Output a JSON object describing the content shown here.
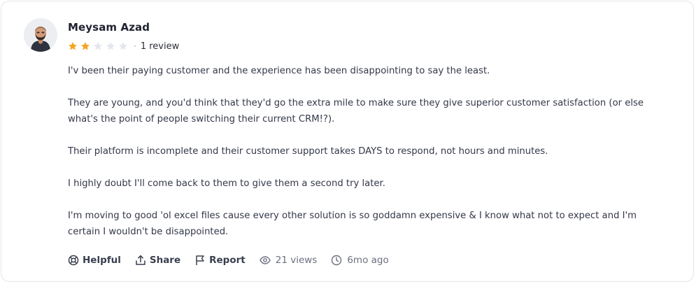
{
  "review": {
    "author": "Meysam Azad",
    "rating": 2,
    "rating_max": 5,
    "separator": "·",
    "review_count": "1 review",
    "paragraphs": [
      "I'v been their paying customer and the experience has been disappointing to say the least.",
      "They are young, and you'd think that they'd go the extra mile to make sure they give superior customer satisfaction (or else what's the point of people switching their current CRM!?).",
      "Their platform is incomplete and their customer support takes DAYS to respond, not hours and minutes.",
      "I highly doubt I'll come back to them to give them a second try later.",
      "I'm moving to good 'ol excel files cause every other solution is so goddamn expensive & I know what not to expect and I'm certain I wouldn't be disappointed."
    ]
  },
  "actions": {
    "helpful": "Helpful",
    "share": "Share",
    "report": "Report",
    "views": "21 views",
    "time": "6mo ago"
  },
  "colors": {
    "star_filled": "#f5a524",
    "star_empty": "#e4e7ec",
    "border": "#e3e5ea"
  },
  "icons": [
    "avatar",
    "star-icon",
    "lifebuoy-icon",
    "share-icon",
    "flag-icon",
    "eye-icon",
    "clock-icon"
  ]
}
